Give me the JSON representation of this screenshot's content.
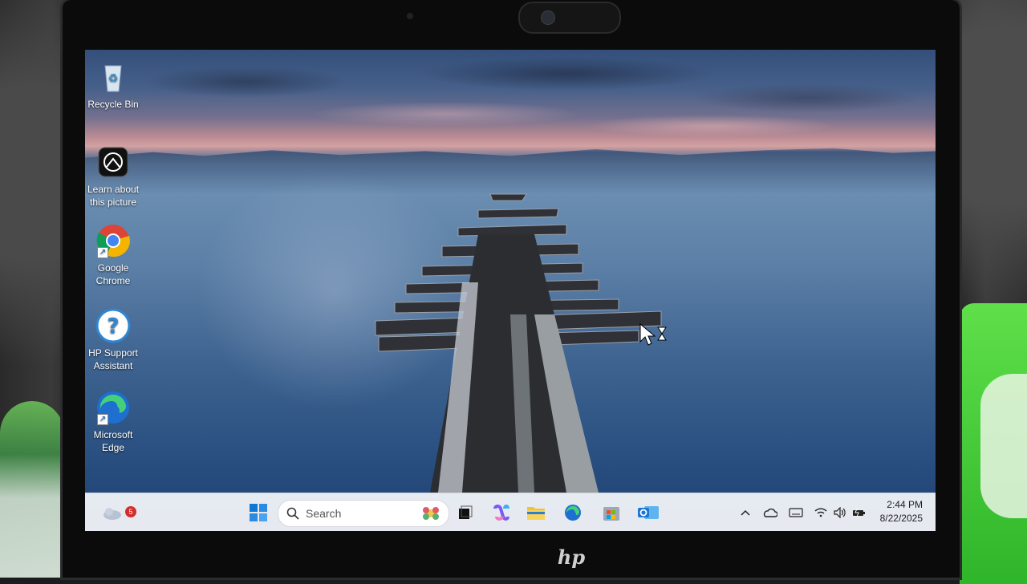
{
  "desktop": {
    "icons": [
      {
        "label_line1": "Recycle Bin",
        "label_line2": "",
        "icon": "recycle-bin-icon"
      },
      {
        "label_line1": "Learn about",
        "label_line2": "this picture",
        "icon": "camera-icon"
      },
      {
        "label_line1": "Google",
        "label_line2": "Chrome",
        "icon": "chrome-icon"
      },
      {
        "label_line1": "HP Support",
        "label_line2": "Assistant",
        "icon": "help-icon"
      },
      {
        "label_line1": "Microsoft",
        "label_line2": "Edge",
        "icon": "edge-icon"
      }
    ]
  },
  "taskbar": {
    "weather_badge": "5",
    "search_placeholder": "Search",
    "pinned": [
      "start-icon",
      "search-icon",
      "task-view-icon",
      "copilot-icon",
      "file-explorer-icon",
      "edge-icon",
      "store-icon",
      "outlook-icon"
    ],
    "tray": [
      "chevron-up-icon",
      "onedrive-icon",
      "keyboard-icon",
      "wifi-icon",
      "volume-icon",
      "battery-icon"
    ],
    "time": "2:44 PM",
    "date": "8/22/2025"
  },
  "colors": {
    "taskbar_bg": "#eef1f6",
    "accent": "#0067c0",
    "badge": "#d42b2b"
  }
}
